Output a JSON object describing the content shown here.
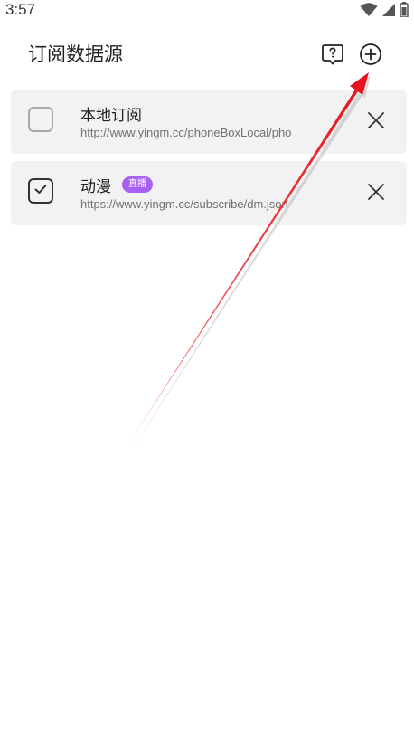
{
  "status_bar": {
    "time": "3:57",
    "icons": [
      "wifi-icon",
      "signal-icon",
      "battery-icon"
    ]
  },
  "header": {
    "title": "订阅数据源",
    "actions": [
      "help-icon",
      "add-circle-icon"
    ]
  },
  "subscriptions": [
    {
      "title": "本地订阅",
      "url": "http://www.yingm.cc/phoneBoxLocal/pho",
      "checked": false,
      "badge": ""
    },
    {
      "title": "动漫",
      "url": "https://www.yingm.cc/subscribe/dm.json",
      "checked": true,
      "badge": "直播"
    }
  ],
  "colors": {
    "card_background": "#f2f2f2",
    "badge": "#a861f0",
    "arrow": "#e8101c"
  }
}
